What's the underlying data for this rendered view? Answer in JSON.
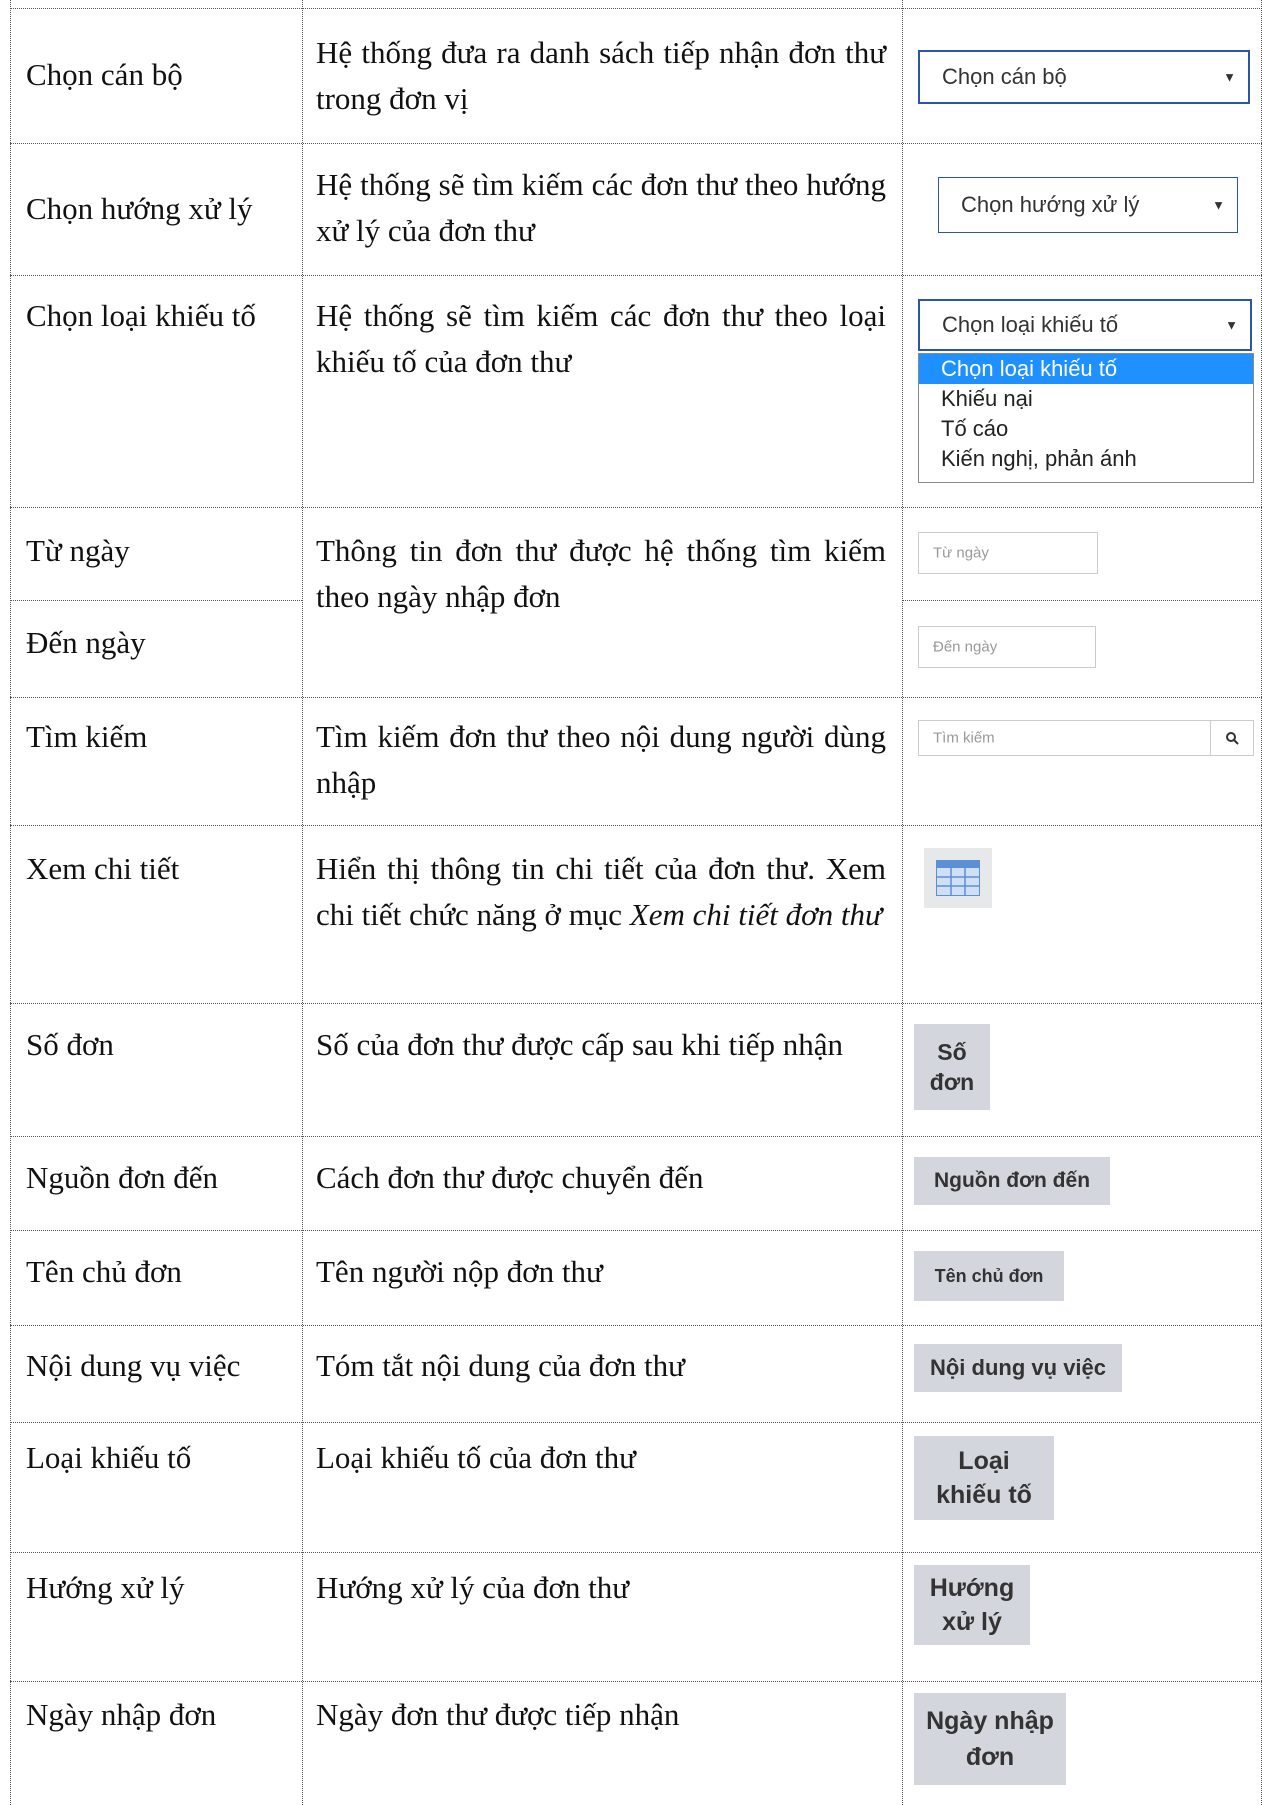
{
  "rows": [
    {
      "label": "Chọn cán bộ",
      "desc": "Hệ thống đưa ra danh sách tiếp nhận đơn thư trong đơn vị"
    },
    {
      "label": "Chọn hướng xử lý",
      "desc": "Hệ thống sẽ tìm kiếm các đơn thư theo hướng xử lý của đơn thư"
    },
    {
      "label": "Chọn loại khiếu tố",
      "desc": "Hệ thống sẽ tìm kiếm các đơn thư theo loại khiếu tố của đơn thư"
    },
    {
      "label": "Từ ngày",
      "desc": "Thông tin đơn thư được hệ thống tìm kiếm theo ngày nhập đơn"
    },
    {
      "label": "Đến ngày"
    },
    {
      "label": "Tìm kiếm",
      "desc": "Tìm kiếm đơn thư theo nội dung người dùng nhập"
    },
    {
      "label": "Xem chi tiết",
      "desc_plain": "Hiển thị thông tin chi tiết của đơn thư. Xem chi tiết chức năng ở mục ",
      "desc_italic": "Xem chi tiết đơn thư"
    },
    {
      "label": "Số đơn",
      "desc": "Số của đơn thư được cấp sau khi tiếp nhận"
    },
    {
      "label": "Nguồn đơn đến",
      "desc": "Cách đơn thư được chuyển đến"
    },
    {
      "label": "Tên chủ đơn",
      "desc": "Tên người nộp đơn thư"
    },
    {
      "label": "Nội dung vụ việc",
      "desc": "Tóm tắt nội dung của đơn thư"
    },
    {
      "label": "Loại khiếu tố",
      "desc": "Loại khiếu tố của đơn thư"
    },
    {
      "label": "Hướng xử lý",
      "desc": "Hướng xử lý của đơn thư"
    },
    {
      "label": "Ngày nhập đơn",
      "desc": "Ngày đơn thư được tiếp nhận"
    }
  ],
  "widgets": {
    "select_can_bo": "Chọn cán bộ",
    "select_huong_xu_ly": "Chọn hướng xử lý",
    "select_loai_khieu_to": "Chọn loại khiếu tố",
    "dropdown_options": [
      "Chọn loại khiếu tố",
      "Khiếu nại",
      "Tố cáo",
      "Kiến nghị, phản ánh"
    ],
    "tu_ngay_placeholder": "Từ ngày",
    "den_ngay_placeholder": "Đến ngày",
    "tim_kiem_placeholder": "Tìm kiếm",
    "btn_so_don": "Số đơn",
    "btn_nguon_don_den": "Nguồn đơn đến",
    "btn_ten_chu_don": "Tên chủ đơn",
    "btn_noi_dung_vu_viec": "Nội dung vụ việc",
    "btn_loai_khieu_to": "Loại khiếu tố",
    "btn_huong_xu_ly": "Hướng xử lý",
    "btn_ngay_nhap_don": "Ngày nhập đơn"
  },
  "colors": {
    "select_border": "#2a55a8",
    "dropdown_highlight": "#1e90ff",
    "header_button_bg": "#d3d7dd",
    "details_icon": "#5b8fd6"
  },
  "icons": {
    "search": "search-icon",
    "details": "details-grid-icon",
    "caret": "caret-down-icon"
  }
}
